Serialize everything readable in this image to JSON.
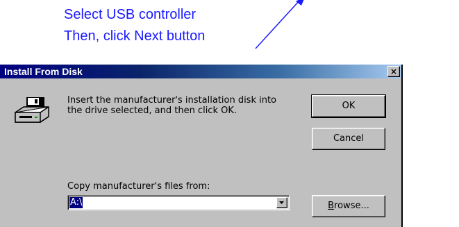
{
  "annotation": {
    "line1": "Select USB controller",
    "line2": "Then, click Next button",
    "color": "#1a1aff"
  },
  "dialog": {
    "title": "Install From Disk",
    "close_label": "×",
    "message_line1": "Insert the manufacturer's installation disk into",
    "message_line2": "the drive selected, and then click OK.",
    "ok_label": "OK",
    "cancel_label": "Cancel",
    "copy_label": "Copy manufacturer's files from:",
    "path_value": "A:\\",
    "browse_label_prefix": "B",
    "browse_label_rest": "rowse...",
    "icon": "floppy-drive-icon"
  }
}
